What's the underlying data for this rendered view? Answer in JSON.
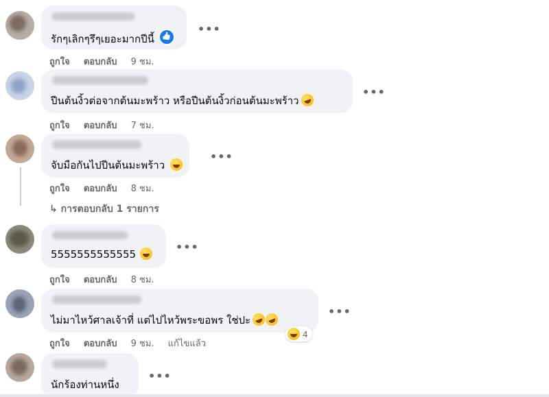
{
  "comments": [
    {
      "text": "รักๆเลิกๆรึๆเยอะมากปีนี้",
      "actions": {
        "like": "ถูกใจ",
        "reply": "ตอบกลับ",
        "time": "9 ชม."
      }
    },
    {
      "text": "ปีนต้นงิ้วต่อจากต้นมะพร้าว หรือปีนต้นงิ้วก่อนต้นมะพร้าว",
      "actions": {
        "like": "ถูกใจ",
        "reply": "ตอบกลับ",
        "time": "7 ชม."
      }
    },
    {
      "text": "จับมือกันไปปีนต้นมะพร้าว",
      "actions": {
        "like": "ถูกใจ",
        "reply": "ตอบกลับ",
        "time": "8 ชม."
      },
      "replies_link": "การตอบกลับ 1 รายการ"
    },
    {
      "text": "5555555555555",
      "actions": {
        "like": "ถูกใจ",
        "reply": "ตอบกลับ",
        "time": "8 ชม."
      }
    },
    {
      "text": "ไม่มาไหว้ศาลเจ้าที่ แต่ไปไหว้พระขอพร ใช่ปะ",
      "actions": {
        "like": "ถูกใจ",
        "reply": "ตอบกลับ",
        "time": "9 ชม.",
        "edited": "แก้ไขแล้ว"
      },
      "reaction_count": "4"
    },
    {
      "text": "นักร้องท่านหนึ่ง"
    }
  ],
  "more_label": "•••",
  "reply_arrow": "↳",
  "icons": {
    "like": "like-reaction-icon",
    "haha": "haha-emoji-icon",
    "more": "more-options-icon"
  }
}
